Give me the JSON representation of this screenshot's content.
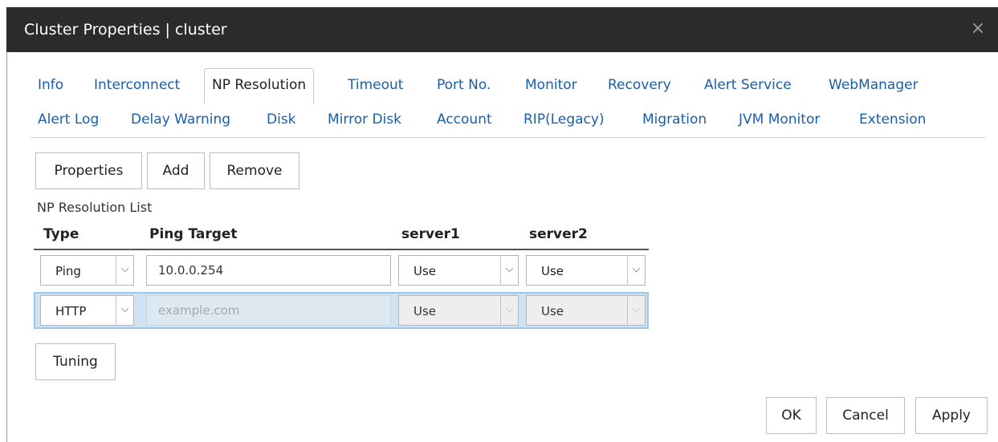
{
  "window": {
    "title": "Cluster Properties | cluster",
    "close_glyph": "×"
  },
  "tabs": {
    "row1": [
      "Info",
      "Interconnect",
      "NP Resolution",
      "Timeout",
      "Port No.",
      "Monitor",
      "Recovery",
      "Alert Service",
      "WebManager"
    ],
    "row2": [
      "Alert Log",
      "Delay Warning",
      "Disk",
      "Mirror Disk",
      "Account",
      "RIP(Legacy)",
      "Migration",
      "JVM Monitor",
      "Extension"
    ],
    "active": "NP Resolution"
  },
  "toolbar": {
    "properties_label": "Properties",
    "add_label": "Add",
    "remove_label": "Remove"
  },
  "list": {
    "title": "NP Resolution List",
    "headers": {
      "type": "Type",
      "target": "Ping Target",
      "server1": "server1",
      "server2": "server2"
    },
    "rows": [
      {
        "type": "Ping",
        "target": "10.0.0.254",
        "server1": "Use",
        "server2": "Use"
      },
      {
        "type": "HTTP",
        "target": "example.com",
        "server1": "Use",
        "server2": "Use"
      }
    ]
  },
  "tuning_label": "Tuning",
  "footer": {
    "ok_label": "OK",
    "cancel_label": "Cancel",
    "apply_label": "Apply"
  },
  "icons": {
    "chevron": "⌵"
  }
}
